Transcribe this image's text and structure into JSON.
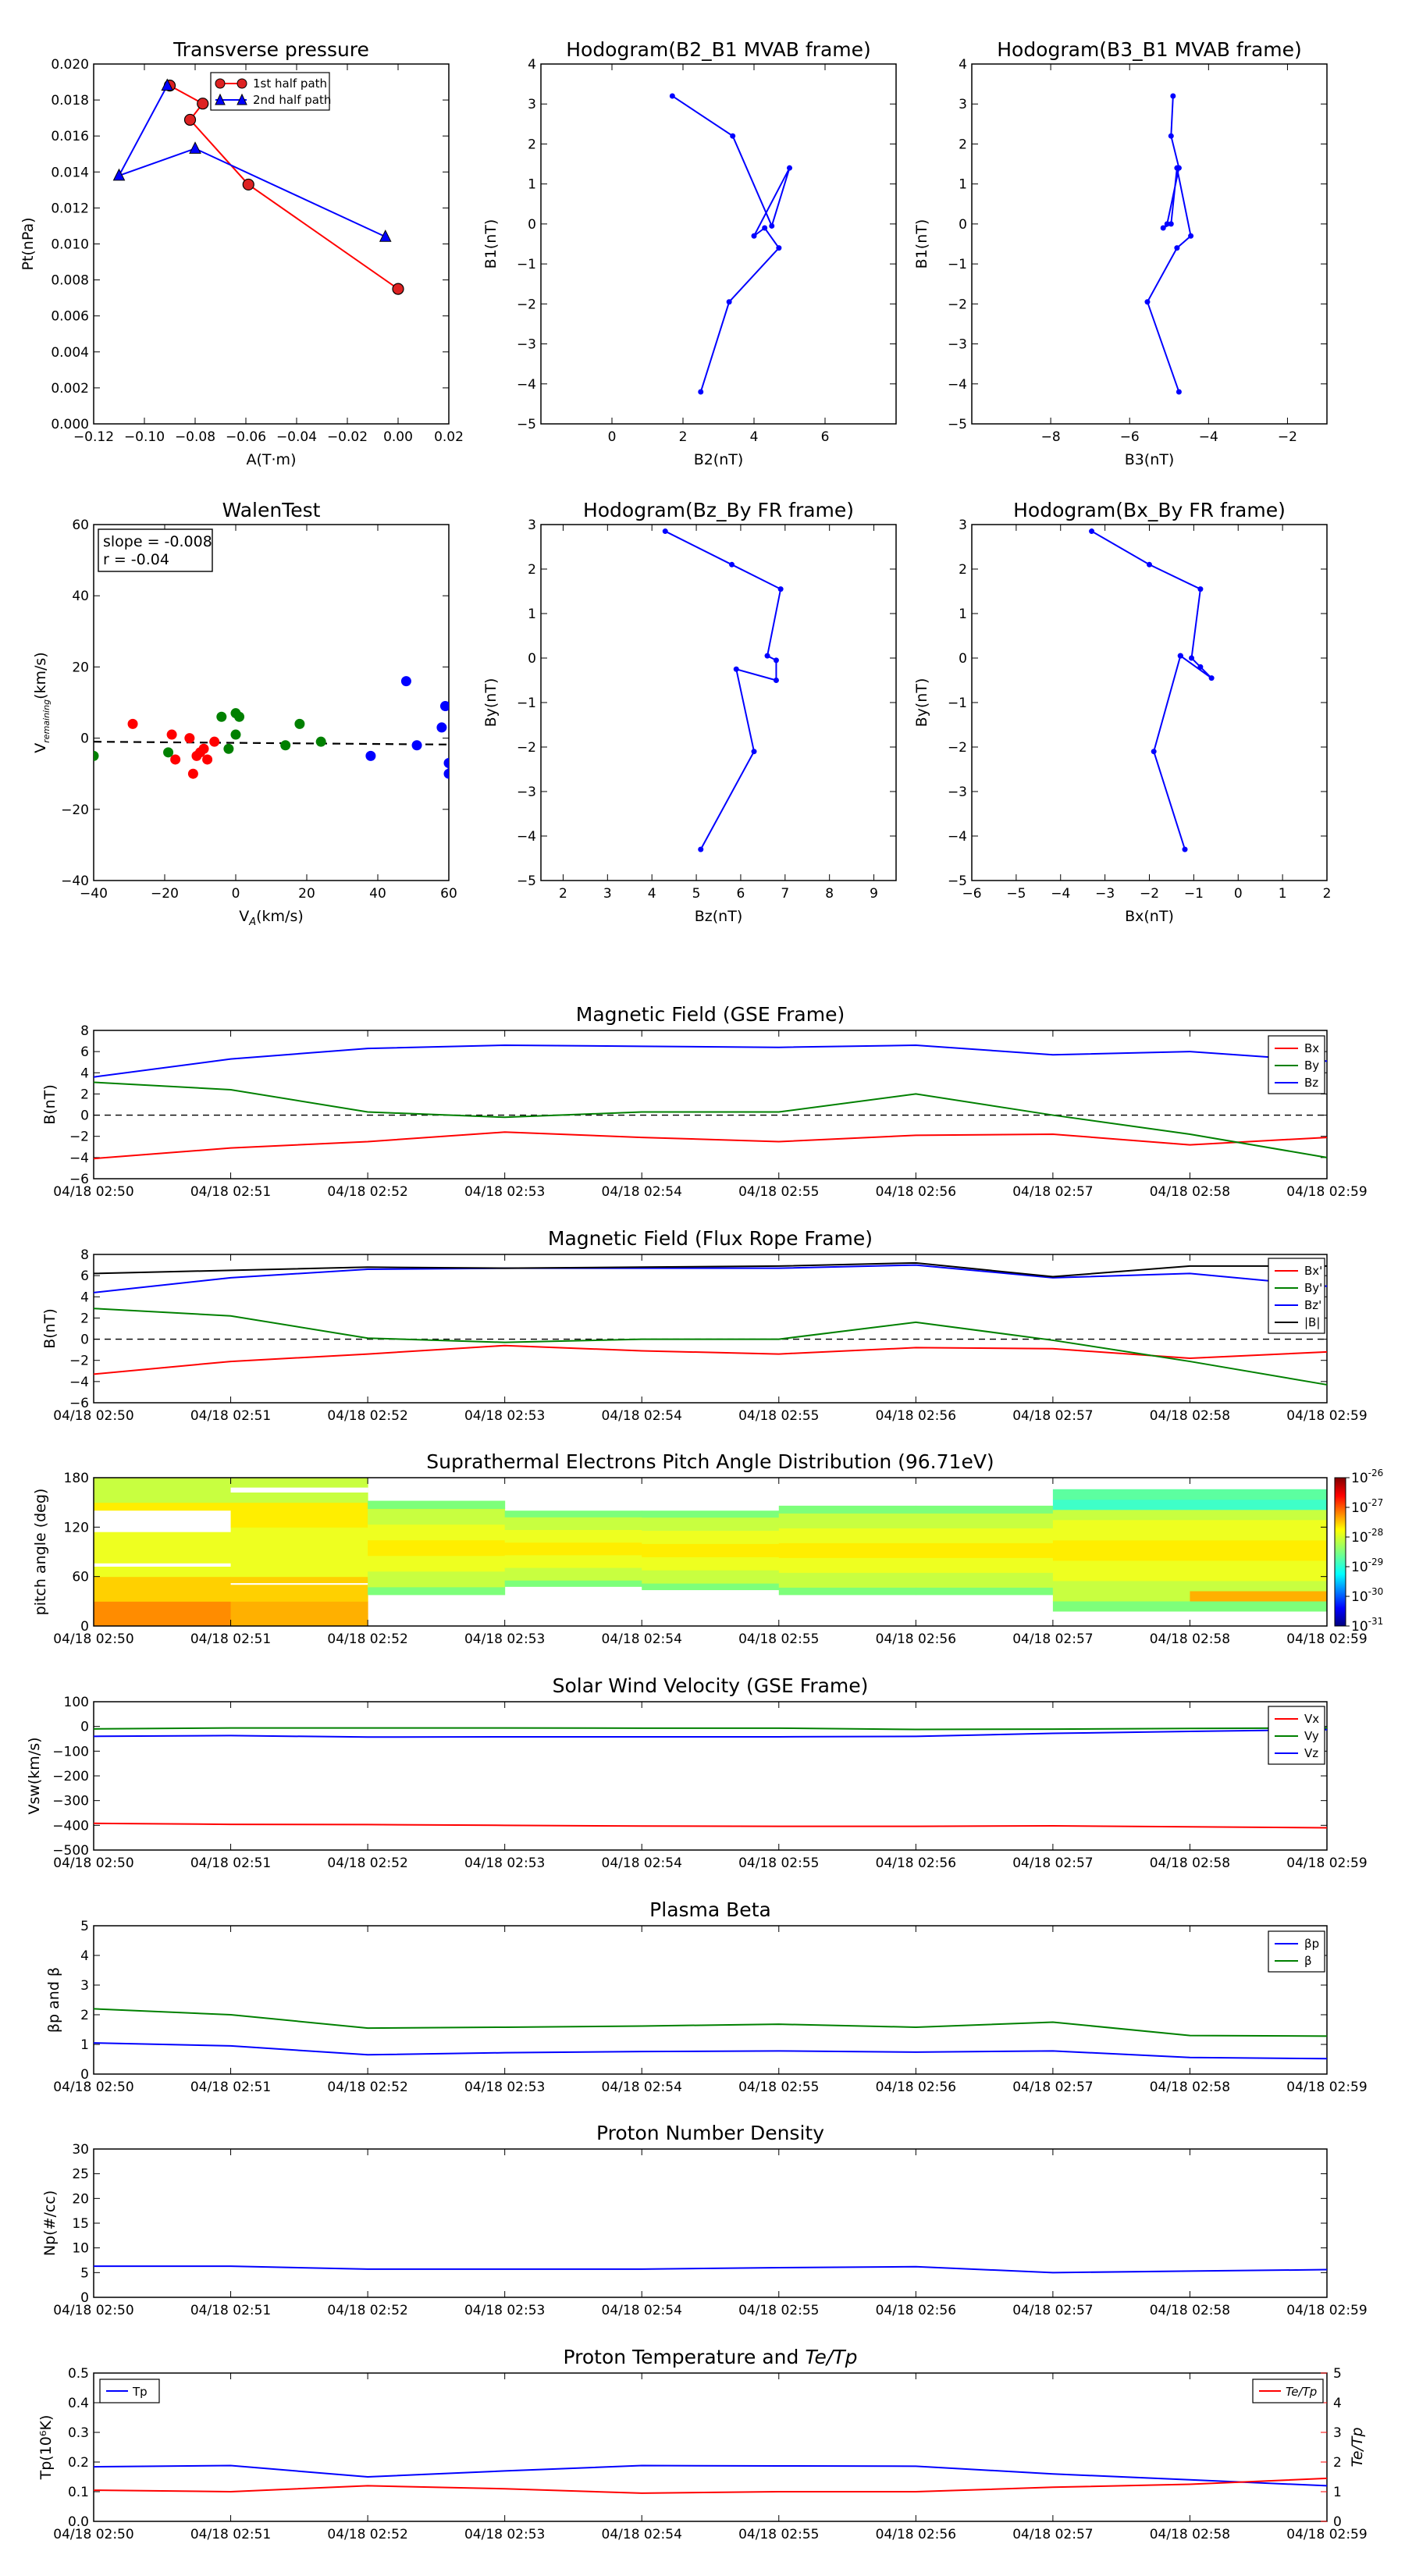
{
  "panels": {
    "transverse_pressure": {
      "title": "Transverse pressure",
      "xlabel": "A(T·m)",
      "ylabel": "Pt(nPa)",
      "xlim": [
        -0.12,
        0.02
      ],
      "ylim": [
        0,
        0.02
      ],
      "xticks": [
        "−0.12",
        "−0.10",
        "−0.08",
        "−0.06",
        "−0.04",
        "−0.02",
        "0.00",
        "0.02"
      ],
      "yticks": [
        "0.000",
        "0.002",
        "0.004",
        "0.006",
        "0.008",
        "0.010",
        "0.012",
        "0.014",
        "0.016",
        "0.018",
        "0.020"
      ],
      "legend": [
        "1st half path",
        "2nd half path"
      ]
    },
    "hodo_b2b1": {
      "title": "Hodogram(B2_B1 MVAB frame)",
      "xlabel": "B2(nT)",
      "ylabel": "B1(nT)",
      "xlim": [
        -2,
        8
      ],
      "ylim": [
        -5,
        4
      ],
      "xticks": [
        "0",
        "2",
        "4",
        "6"
      ],
      "yticks": [
        "−5",
        "−4",
        "−3",
        "−2",
        "−1",
        "0",
        "1",
        "2",
        "3",
        "4"
      ]
    },
    "hodo_b3b1": {
      "title": "Hodogram(B3_B1 MVAB frame)",
      "xlabel": "B3(nT)",
      "ylabel": "B1(nT)",
      "xlim": [
        -10,
        -1
      ],
      "ylim": [
        -5,
        4
      ],
      "xticks": [
        "−8",
        "−6",
        "−4",
        "−2"
      ],
      "yticks": [
        "−5",
        "−4",
        "−3",
        "−2",
        "−1",
        "0",
        "1",
        "2",
        "3",
        "4"
      ]
    },
    "walen": {
      "title": "WalenTest",
      "ylabel_text": "V",
      "ylabel_sub": "remaining",
      "ylabel_tail": "(km/s)",
      "xlabel_text": "V",
      "xlabel_sub": "A",
      "xlabel_tail": "(km/s)",
      "xlim": [
        -40,
        60
      ],
      "ylim": [
        -40,
        60
      ],
      "xticks": [
        "−40",
        "−20",
        "0",
        "20",
        "40",
        "60"
      ],
      "yticks": [
        "−40",
        "−20",
        "0",
        "20",
        "40",
        "60"
      ],
      "annotation_slope": "slope = -0.008",
      "annotation_r": "r = -0.04"
    },
    "hodo_bzby": {
      "title": "Hodogram(Bz_By FR frame)",
      "xlabel": "Bz(nT)",
      "ylabel": "By(nT)",
      "xlim": [
        1.5,
        9.5
      ],
      "ylim": [
        -5,
        3
      ],
      "xticks": [
        "2",
        "3",
        "4",
        "5",
        "6",
        "7",
        "8",
        "9"
      ],
      "yticks": [
        "−5",
        "−4",
        "−3",
        "−2",
        "−1",
        "0",
        "1",
        "2",
        "3"
      ]
    },
    "hodo_bxby": {
      "title": "Hodogram(Bx_By FR frame)",
      "xlabel": "Bx(nT)",
      "ylabel": "By(nT)",
      "xlim": [
        -6,
        2
      ],
      "ylim": [
        -5,
        3
      ],
      "xticks": [
        "−6",
        "−5",
        "−4",
        "−3",
        "−2",
        "−1",
        "0",
        "1",
        "2"
      ],
      "yticks": [
        "−5",
        "−4",
        "−3",
        "−2",
        "−1",
        "0",
        "1",
        "2",
        "3"
      ]
    },
    "mag_gse": {
      "title": "Magnetic Field (GSE Frame)",
      "ylabel": "B(nT)",
      "ylim": [
        -6,
        8
      ],
      "yticks": [
        "−6",
        "−4",
        "−2",
        "0",
        "2",
        "4",
        "6",
        "8"
      ],
      "legend": [
        "Bx",
        "By",
        "Bz"
      ]
    },
    "mag_fr": {
      "title": "Magnetic Field (Flux Rope Frame)",
      "ylabel": "B(nT)",
      "ylim": [
        -6,
        8
      ],
      "yticks": [
        "−6",
        "−4",
        "−2",
        "0",
        "2",
        "4",
        "6",
        "8"
      ],
      "legend": [
        "Bx'",
        "By'",
        "Bz'",
        "|B|"
      ]
    },
    "pad": {
      "title": "Suprathermal Electrons Pitch Angle Distribution (96.71eV)",
      "ylabel": "pitch angle (deg)",
      "ylim": [
        0,
        180
      ],
      "yticks": [
        "0",
        "60",
        "120",
        "180"
      ],
      "colorbar_base": "10",
      "colorbar_exponents": [
        "-31",
        "-30",
        "-29",
        "-28",
        "-27",
        "-26"
      ]
    },
    "vsw": {
      "title": "Solar Wind Velocity (GSE Frame)",
      "ylabel": "Vsw(km/s)",
      "ylim": [
        -500,
        100
      ],
      "yticks": [
        "−500",
        "−400",
        "−300",
        "−200",
        "−100",
        "0",
        "100"
      ],
      "legend": [
        "Vx",
        "Vy",
        "Vz"
      ]
    },
    "beta": {
      "title": "Plasma Beta",
      "ylabel": "βp and β",
      "ylim": [
        0,
        5
      ],
      "yticks": [
        "0",
        "1",
        "2",
        "3",
        "4",
        "5"
      ],
      "legend": [
        "βp",
        "β"
      ]
    },
    "np": {
      "title": "Proton Number Density",
      "ylabel": "Np(#/cc)",
      "ylim": [
        0,
        30
      ],
      "yticks": [
        "0",
        "5",
        "10",
        "15",
        "20",
        "25",
        "30"
      ]
    },
    "tp": {
      "title_text": "Proton Temperature and ",
      "title_math": "Te/Tp",
      "ylabel": "Tp(10⁶K)",
      "ylabel_right": "Te/Tp",
      "ylim": [
        0,
        0.5
      ],
      "ylim_right": [
        0,
        5
      ],
      "yticks": [
        "0.0",
        "0.1",
        "0.2",
        "0.3",
        "0.4",
        "0.5"
      ],
      "yticks_right": [
        "0",
        "1",
        "2",
        "3",
        "4",
        "5"
      ],
      "legend_left": "Tp",
      "legend_right": "Te/Tp"
    },
    "time_ticks": [
      "04/18 02:50",
      "04/18 02:51",
      "04/18 02:52",
      "04/18 02:53",
      "04/18 02:54",
      "04/18 02:55",
      "04/18 02:56",
      "04/18 02:57",
      "04/18 02:58",
      "04/18 02:59"
    ],
    "colors": {
      "red": "#ff0000",
      "green": "#008000",
      "blue": "#0000ff",
      "black": "#000000"
    }
  },
  "chart_data": [
    {
      "type": "scatter",
      "title": "Transverse pressure",
      "xlabel": "A(T·m)",
      "ylabel": "Pt(nPa)",
      "xlim": [
        -0.12,
        0.02
      ],
      "ylim": [
        0,
        0.02
      ],
      "series": [
        {
          "name": "1st half path",
          "x": [
            0.0,
            -0.059,
            -0.082,
            -0.077,
            -0.09
          ],
          "y": [
            0.0075,
            0.0133,
            0.0169,
            0.0178,
            0.0188
          ]
        },
        {
          "name": "2nd half path",
          "x": [
            -0.091,
            -0.11,
            -0.08,
            -0.005
          ],
          "y": [
            0.0188,
            0.0138,
            0.0153,
            0.0104
          ]
        }
      ]
    },
    {
      "type": "line",
      "title": "Hodogram(B2_B1 MVAB frame)",
      "xlabel": "B2(nT)",
      "ylabel": "B1(nT)",
      "xlim": [
        -2,
        8
      ],
      "ylim": [
        -5,
        4
      ],
      "x": [
        2.5,
        3.3,
        4.7,
        4.3,
        4.0,
        5.0,
        4.5,
        3.4,
        1.7
      ],
      "y": [
        -4.2,
        -1.95,
        -0.6,
        -0.1,
        -0.3,
        1.4,
        -0.05,
        2.2,
        3.2
      ]
    },
    {
      "type": "line",
      "title": "Hodogram(B3_B1 MVAB frame)",
      "xlabel": "B3(nT)",
      "ylabel": "B1(nT)",
      "xlim": [
        -10,
        -1
      ],
      "ylim": [
        -5,
        4
      ],
      "x": [
        -4.75,
        -5.55,
        -4.8,
        -4.45,
        -4.8,
        -4.95,
        -5.15,
        -5.05,
        -4.75,
        -4.95,
        -4.9
      ],
      "y": [
        -4.2,
        -1.95,
        -0.6,
        -0.3,
        1.4,
        0.0,
        -0.1,
        0.0,
        1.4,
        2.2,
        3.2
      ]
    },
    {
      "type": "scatter",
      "title": "WalenTest",
      "xlim": [
        -40,
        60
      ],
      "ylim": [
        -40,
        60
      ],
      "series": [
        {
          "name": "",
          "color": "red",
          "x": [
            -29,
            -18,
            -17,
            -13,
            -12,
            -11,
            -10,
            -9,
            -8,
            -6
          ],
          "y": [
            4,
            1,
            -6,
            0,
            -10,
            -5,
            -4,
            -3,
            -6,
            -1
          ]
        },
        {
          "name": "",
          "color": "green",
          "x": [
            -40,
            -19,
            -4,
            -2,
            0,
            0,
            1,
            14,
            18,
            24
          ],
          "y": [
            -5,
            -4,
            6,
            -3,
            7,
            1,
            6,
            -2,
            4,
            -1
          ]
        },
        {
          "name": "",
          "color": "blue",
          "x": [
            38,
            48,
            51,
            58,
            59,
            60,
            60,
            61
          ],
          "y": [
            -5,
            16,
            -2,
            3,
            9,
            -7,
            -10,
            -8
          ]
        }
      ],
      "fit_line": {
        "x": [
          -40,
          60
        ],
        "y": [
          -1.0,
          -1.8
        ]
      }
    },
    {
      "type": "line",
      "title": "Hodogram(Bz_By FR frame)",
      "xlabel": "Bz(nT)",
      "ylabel": "By(nT)",
      "xlim": [
        1.5,
        9.5
      ],
      "ylim": [
        -5,
        3
      ],
      "x": [
        5.1,
        6.3,
        5.9,
        6.8,
        6.8,
        6.6,
        6.9,
        5.8,
        4.3
      ],
      "y": [
        -4.3,
        -2.1,
        -0.25,
        -0.5,
        -0.05,
        0.05,
        1.55,
        2.1,
        2.85
      ]
    },
    {
      "type": "line",
      "title": "Hodogram(Bx_By FR frame)",
      "xlabel": "Bx(nT)",
      "ylabel": "By(nT)",
      "xlim": [
        -6,
        2
      ],
      "ylim": [
        -5,
        3
      ],
      "x": [
        -1.2,
        -1.9,
        -1.3,
        -1.3,
        -0.6,
        -0.85,
        -1.05,
        -0.85,
        -2.0,
        -3.3
      ],
      "y": [
        -4.3,
        -2.1,
        0.05,
        0.05,
        -0.45,
        -0.2,
        0.0,
        1.55,
        2.1,
        2.85
      ]
    },
    {
      "type": "line",
      "title": "Magnetic Field (GSE Frame)",
      "ylabel": "B(nT)",
      "ylim": [
        -6,
        8
      ],
      "x": [
        "02:50",
        "02:51",
        "02:52",
        "02:53",
        "02:54",
        "02:55",
        "02:56",
        "02:57",
        "02:58",
        "02:59"
      ],
      "series": [
        {
          "name": "Bx",
          "color": "red",
          "values": [
            -4.1,
            -3.1,
            -2.5,
            -1.6,
            -2.1,
            -2.5,
            -1.9,
            -1.8,
            -2.8,
            -2.1
          ]
        },
        {
          "name": "By",
          "color": "green",
          "values": [
            3.1,
            2.4,
            0.3,
            -0.2,
            0.3,
            0.3,
            2.0,
            0.0,
            -1.8,
            -4.0
          ]
        },
        {
          "name": "Bz",
          "color": "blue",
          "values": [
            3.6,
            5.3,
            6.3,
            6.6,
            6.5,
            6.4,
            6.6,
            5.7,
            6.0,
            5.1
          ]
        }
      ]
    },
    {
      "type": "line",
      "title": "Magnetic Field (Flux Rope Frame)",
      "ylabel": "B(nT)",
      "ylim": [
        -6,
        8
      ],
      "x": [
        "02:50",
        "02:51",
        "02:52",
        "02:53",
        "02:54",
        "02:55",
        "02:56",
        "02:57",
        "02:58",
        "02:59"
      ],
      "series": [
        {
          "name": "Bx'",
          "color": "red",
          "values": [
            -3.3,
            -2.1,
            -1.4,
            -0.6,
            -1.1,
            -1.4,
            -0.8,
            -0.9,
            -1.8,
            -1.2
          ]
        },
        {
          "name": "By'",
          "color": "green",
          "values": [
            2.9,
            2.2,
            0.1,
            -0.3,
            0.0,
            0.0,
            1.6,
            -0.1,
            -2.1,
            -4.3
          ]
        },
        {
          "name": "Bz'",
          "color": "blue",
          "values": [
            4.4,
            5.8,
            6.6,
            6.7,
            6.7,
            6.7,
            7.0,
            5.8,
            6.2,
            5.0
          ]
        },
        {
          "name": "|B|",
          "color": "black",
          "values": [
            6.2,
            6.5,
            6.8,
            6.7,
            6.8,
            6.9,
            7.2,
            5.9,
            6.9,
            6.9
          ]
        }
      ]
    },
    {
      "type": "heatmap",
      "title": "Suprathermal Electrons Pitch Angle Distribution (96.71eV)",
      "ylabel": "pitch angle (deg)",
      "ylim": [
        0,
        180
      ],
      "colorbar": {
        "min_exponent": -31,
        "max_exponent": -26
      },
      "intervals": [
        {
          "t": "02:50",
          "top_deg": 180,
          "bottom_deg": 0,
          "gaps_deg": [
            [
              114,
              140
            ],
            [
              72,
              76
            ]
          ]
        },
        {
          "t": "02:51",
          "top_deg": 180,
          "bottom_deg": 0,
          "gaps_deg": [
            [
              162,
              168
            ],
            [
              50,
              52
            ]
          ]
        },
        {
          "t": "02:52",
          "top_deg": 152,
          "bottom_deg": 38
        },
        {
          "t": "02:53",
          "top_deg": 140,
          "bottom_deg": 48
        },
        {
          "t": "02:54",
          "top_deg": 140,
          "bottom_deg": 44
        },
        {
          "t": "02:55",
          "top_deg": 146,
          "bottom_deg": 38
        },
        {
          "t": "02:56",
          "top_deg": 146,
          "bottom_deg": 38
        },
        {
          "t": "02:57",
          "top_deg": 166,
          "bottom_deg": 18
        },
        {
          "t": "02:58",
          "top_deg": 166,
          "bottom_deg": 18
        }
      ]
    },
    {
      "type": "line",
      "title": "Solar Wind Velocity (GSE Frame)",
      "ylabel": "Vsw(km/s)",
      "ylim": [
        -500,
        100
      ],
      "x": [
        "02:50",
        "02:51",
        "02:52",
        "02:53",
        "02:54",
        "02:55",
        "02:56",
        "02:57",
        "02:58",
        "02:59"
      ],
      "series": [
        {
          "name": "Vx",
          "color": "red",
          "values": [
            -392,
            -396,
            -397,
            -400,
            -403,
            -404,
            -404,
            -402,
            -406,
            -410
          ]
        },
        {
          "name": "Vy",
          "color": "green",
          "values": [
            -10,
            -6,
            -6,
            -6,
            -7,
            -7,
            -12,
            -11,
            -8,
            -6
          ]
        },
        {
          "name": "Vz",
          "color": "blue",
          "values": [
            -40,
            -37,
            -43,
            -42,
            -42,
            -42,
            -40,
            -28,
            -20,
            -13
          ]
        }
      ]
    },
    {
      "type": "line",
      "title": "Plasma Beta",
      "ylim": [
        0,
        5
      ],
      "x": [
        "02:50",
        "02:51",
        "02:52",
        "02:53",
        "02:54",
        "02:55",
        "02:56",
        "02:57",
        "02:58",
        "02:59"
      ],
      "series": [
        {
          "name": "βp",
          "color": "blue",
          "values": [
            1.05,
            0.95,
            0.65,
            0.72,
            0.76,
            0.78,
            0.74,
            0.78,
            0.56,
            0.52
          ]
        },
        {
          "name": "β",
          "color": "green",
          "values": [
            2.2,
            2.0,
            1.55,
            1.58,
            1.62,
            1.68,
            1.58,
            1.75,
            1.3,
            1.28
          ]
        }
      ]
    },
    {
      "type": "line",
      "title": "Proton Number Density",
      "ylabel": "Np(#/cc)",
      "ylim": [
        0,
        30
      ],
      "x": [
        "02:50",
        "02:51",
        "02:52",
        "02:53",
        "02:54",
        "02:55",
        "02:56",
        "02:57",
        "02:58",
        "02:59"
      ],
      "series": [
        {
          "name": "",
          "color": "blue",
          "values": [
            6.3,
            6.3,
            5.7,
            5.7,
            5.7,
            6.0,
            6.2,
            5.0,
            5.3,
            5.6
          ]
        }
      ]
    },
    {
      "type": "line",
      "ylim": [
        0,
        0.5
      ],
      "ylim_right": [
        0,
        5
      ],
      "x": [
        "02:50",
        "02:51",
        "02:52",
        "02:53",
        "02:54",
        "02:55",
        "02:56",
        "02:57",
        "02:58",
        "02:59"
      ],
      "series": [
        {
          "name": "Tp",
          "color": "blue",
          "axis": "left",
          "values": [
            0.184,
            0.188,
            0.15,
            0.17,
            0.188,
            0.187,
            0.186,
            0.16,
            0.14,
            0.12
          ]
        },
        {
          "name": "Te/Tp",
          "color": "red",
          "axis": "right",
          "values": [
            1.05,
            1.0,
            1.2,
            1.1,
            0.95,
            1.0,
            1.0,
            1.15,
            1.25,
            1.45
          ]
        }
      ]
    }
  ]
}
